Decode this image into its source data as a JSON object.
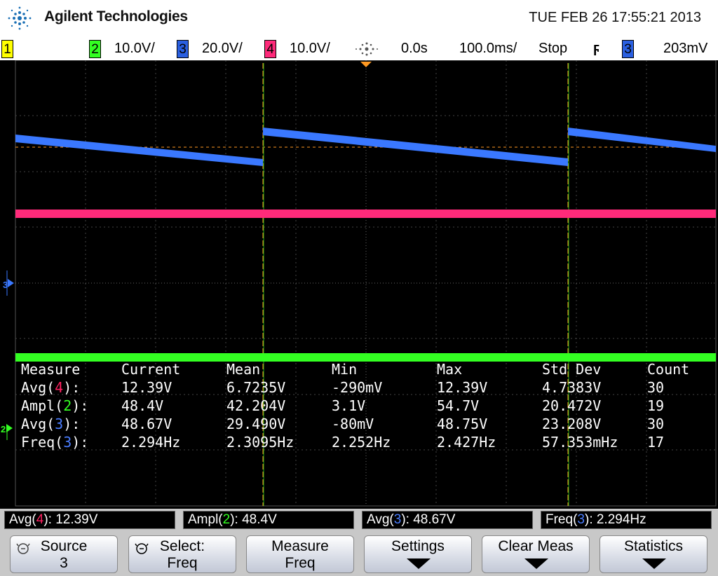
{
  "header": {
    "brand": "Agilent Technologies",
    "datetime": "TUE FEB 26 17:55:21 2013"
  },
  "status": {
    "ch1_num": "1",
    "ch2_num": "2",
    "ch2_scale": "10.0V/",
    "ch3_num": "3",
    "ch3_scale": "20.0V/",
    "ch4_num": "4",
    "ch4_scale": "10.0V/",
    "delay": "0.0s",
    "timebase": "100.0ms/",
    "run_state": "Stop",
    "trigger_slope": "ϝ",
    "trig_src_num": "3",
    "trig_level": "203mV"
  },
  "colors": {
    "ch2": "#33ff22",
    "ch3": "#3a78ff",
    "ch4": "#ff2a7a",
    "grid": "#5a5a5a",
    "cursor": "#ff9922"
  },
  "channel_markers": {
    "ch3_marker": "3",
    "ch2_marker": "2"
  },
  "measurements": {
    "headers": [
      "Measure",
      "Current",
      "Mean",
      "Min",
      "Max",
      "Std Dev",
      "Count"
    ],
    "rows": [
      {
        "name": "Avg",
        "src": "4",
        "src_color": "ch4",
        "current": "12.39V",
        "mean": "6.7235V",
        "min": "-290mV",
        "max": "12.39V",
        "std": "4.7383V",
        "count": "30"
      },
      {
        "name": "Ampl",
        "src": "2",
        "src_color": "ch2",
        "current": "48.4V",
        "mean": "42.204V",
        "min": "3.1V",
        "max": "54.7V",
        "std": "20.472V",
        "count": "19"
      },
      {
        "name": "Avg",
        "src": "3",
        "src_color": "ch3",
        "current": "48.67V",
        "mean": "29.490V",
        "min": "-80mV",
        "max": "48.75V",
        "std": "23.208V",
        "count": "30"
      },
      {
        "name": "Freq",
        "src": "3",
        "src_color": "ch3",
        "current": "2.294Hz",
        "mean": "2.3095Hz",
        "min": "2.252Hz",
        "max": "2.427Hz",
        "std": "57.353mHz",
        "count": "17"
      }
    ]
  },
  "bottom_measurements": [
    {
      "name": "Avg",
      "src": "4",
      "src_color": "ch4",
      "value": ": 12.39V"
    },
    {
      "name": "Ampl",
      "src": "2",
      "src_color": "ch2",
      "value": ": 48.4V"
    },
    {
      "name": "Avg",
      "src": "3",
      "src_color": "ch3",
      "value": ": 48.67V"
    },
    {
      "name": "Freq",
      "src": "3",
      "src_color": "ch3",
      "value": ": 2.294Hz"
    }
  ],
  "softkeys": [
    {
      "line1": "Source",
      "line2": "3",
      "icon": "rotary-knob-icon"
    },
    {
      "line1": "Select:",
      "line2": "Freq",
      "icon": "rotary-knob-icon"
    },
    {
      "line1": "Measure",
      "line2": "Freq",
      "icon": ""
    },
    {
      "line1": "Settings",
      "line2": "",
      "icon": "submenu-arrow-icon"
    },
    {
      "line1": "Clear Meas",
      "line2": "",
      "icon": "submenu-arrow-icon"
    },
    {
      "line1": "Statistics",
      "line2": "",
      "icon": "submenu-arrow-icon"
    }
  ]
}
